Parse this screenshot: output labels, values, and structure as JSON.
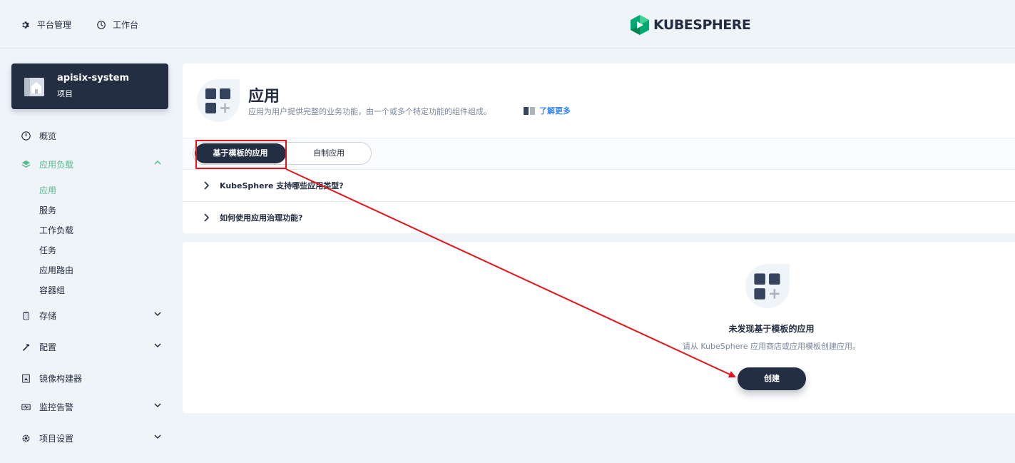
{
  "topbar": {
    "platform_label": "平台管理",
    "workbench_label": "工作台",
    "logo_text": "KUBESPHERE"
  },
  "project": {
    "name": "apisix-system",
    "type": "项目"
  },
  "sidebar": {
    "overview": "概览",
    "workloads": "应用负载",
    "workload_children": [
      "应用",
      "服务",
      "工作负载",
      "任务",
      "应用路由",
      "容器组"
    ],
    "storage": "存储",
    "config": "配置",
    "image_builder": "镜像构建器",
    "monitoring": "监控告警",
    "project_settings": "项目设置"
  },
  "header": {
    "title": "应用",
    "description": "应用为用户提供完整的业务功能，由一个或多个特定功能的组件组成。",
    "learn_more": "了解更多"
  },
  "tabs": {
    "template_apps": "基于模板的应用",
    "custom_apps": "自制应用"
  },
  "faq": [
    "KubeSphere 支持哪些应用类型?",
    "如何使用应用治理功能?"
  ],
  "empty": {
    "title": "未发现基于模板的应用",
    "description": "请从 KubeSphere 应用商店或应用模板创建应用。",
    "create_button": "创建"
  },
  "colors": {
    "accent_green": "#55bc8a",
    "dark": "#242e42",
    "annotation_red": "#e4161c"
  }
}
